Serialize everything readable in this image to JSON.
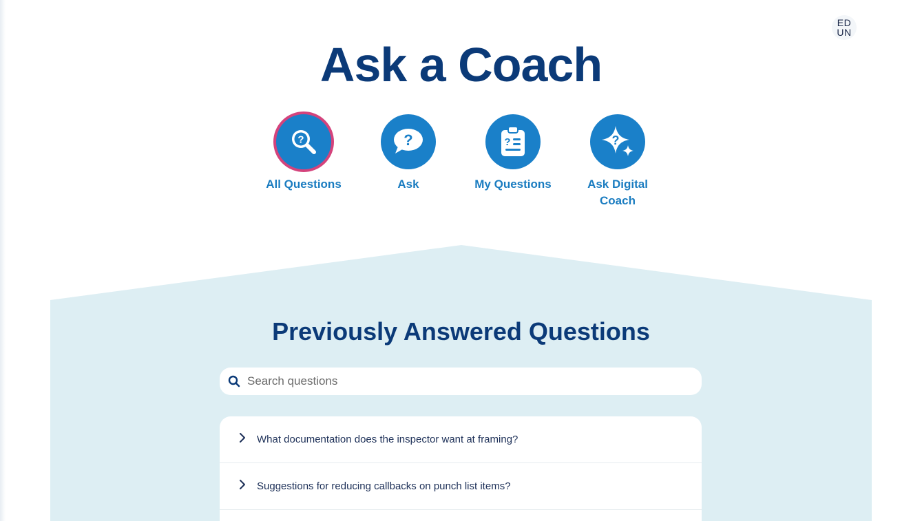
{
  "user": {
    "initials_line1": "ED",
    "initials_line2": "UN"
  },
  "header": {
    "title": "Ask a Coach"
  },
  "nav": {
    "items": [
      {
        "label": "All Questions",
        "icon": "search-question-icon",
        "active": true
      },
      {
        "label": "Ask",
        "icon": "speech-question-icon",
        "active": false
      },
      {
        "label": "My Questions",
        "icon": "clipboard-question-icon",
        "active": false
      },
      {
        "label": "Ask Digital Coach",
        "icon": "sparkle-question-icon",
        "active": false
      }
    ]
  },
  "answered": {
    "title": "Previously Answered Questions",
    "search": {
      "placeholder": "Search questions",
      "value": ""
    },
    "questions": [
      {
        "text": "What documentation does the inspector want at framing?"
      },
      {
        "text": "Suggestions for reducing callbacks on punch list items?"
      }
    ]
  },
  "colors": {
    "title": "#0b3a78",
    "accent": "#1a80c9",
    "nav_label": "#1a7cc0",
    "active_ring": "#d4437c",
    "section_bg": "#ddeef3"
  }
}
